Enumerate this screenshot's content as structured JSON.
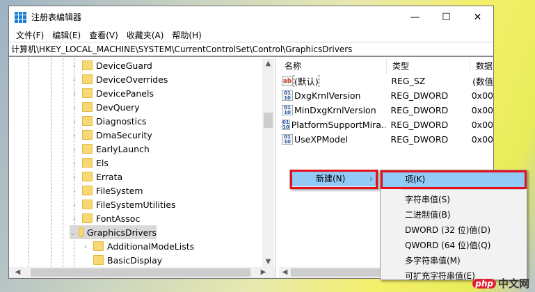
{
  "window": {
    "title": "注册表编辑器",
    "minimize": "—",
    "maximize": "☐",
    "close": "✕"
  },
  "menubar": [
    "文件(F)",
    "编辑(E)",
    "查看(V)",
    "收藏夹(A)",
    "帮助(H)"
  ],
  "address": "计算机\\HKEY_LOCAL_MACHINE\\SYSTEM\\CurrentControlSet\\Control\\GraphicsDrivers",
  "tree": [
    {
      "label": "DeviceGuard",
      "expand": "›"
    },
    {
      "label": "DeviceOverrides",
      "expand": "›"
    },
    {
      "label": "DevicePanels",
      "expand": "›"
    },
    {
      "label": "DevQuery",
      "expand": "›"
    },
    {
      "label": "Diagnostics",
      "expand": "›"
    },
    {
      "label": "DmaSecurity",
      "expand": "›"
    },
    {
      "label": "EarlyLaunch",
      "expand": "›"
    },
    {
      "label": "Els",
      "expand": "›"
    },
    {
      "label": "Errata",
      "expand": "›"
    },
    {
      "label": "FileSystem",
      "expand": "›"
    },
    {
      "label": "FileSystemUtilities",
      "expand": "›"
    },
    {
      "label": "FontAssoc",
      "expand": "›"
    },
    {
      "label": "GraphicsDrivers",
      "expand": "⌄"
    },
    {
      "label": "AdditionalModeLists",
      "expand": "›"
    },
    {
      "label": "BasicDisplay",
      "expand": ""
    }
  ],
  "columns": [
    "名称",
    "类型",
    "数据"
  ],
  "values": [
    {
      "name": "(默认)",
      "type": "REG_SZ",
      "data": "(数值",
      "icon": "ab"
    },
    {
      "name": "DxgKrnlVersion",
      "type": "REG_DWORD",
      "data": "0x00",
      "icon": "bin"
    },
    {
      "name": "MinDxgKrnlVersion",
      "type": "REG_DWORD",
      "data": "0x00",
      "icon": "bin"
    },
    {
      "name": "PlatformSupportMira...",
      "type": "REG_DWORD",
      "data": "0x00",
      "icon": "bin"
    },
    {
      "name": "UseXPModel",
      "type": "REG_DWORD",
      "data": "0x00",
      "icon": "bin"
    }
  ],
  "context_menu": {
    "new": "新建(N)",
    "arrow": "›"
  },
  "submenu": [
    "项(K)",
    "字符串值(S)",
    "二进制值(B)",
    "DWORD (32 位)值(D)",
    "QWORD (64 位)值(Q)",
    "多字符串值(M)",
    "可扩充字符串值(E)"
  ],
  "watermark": {
    "php": "php",
    "cn": "中文网"
  },
  "colors": {
    "highlight": "#91c9f7",
    "annotation": "#e3101b"
  }
}
